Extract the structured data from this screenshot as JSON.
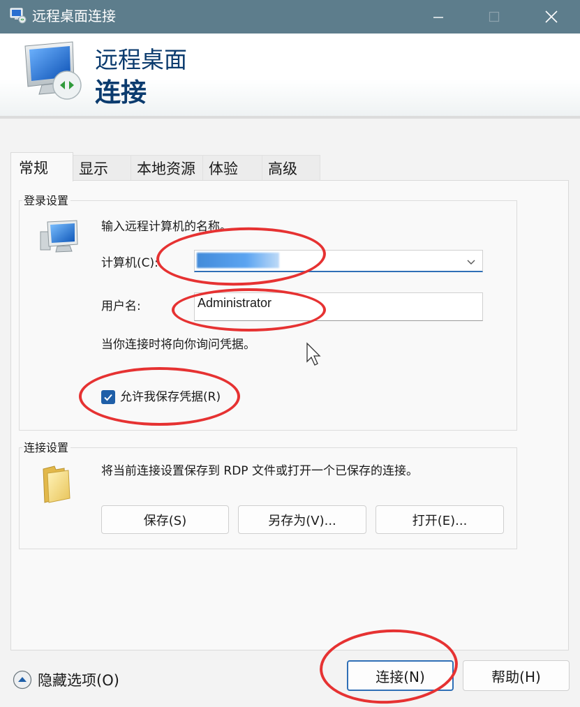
{
  "window": {
    "title": "远程桌面连接"
  },
  "banner": {
    "title": "远程桌面",
    "subtitle": "连接"
  },
  "tabs": [
    {
      "label": "常规",
      "active": true
    },
    {
      "label": "显示",
      "active": false
    },
    {
      "label": "本地资源",
      "active": false
    },
    {
      "label": "体验",
      "active": false
    },
    {
      "label": "高级",
      "active": false
    }
  ],
  "login_settings": {
    "group_label": "登录设置",
    "instruction": "输入远程计算机的名称。",
    "computer_label": "计算机(C):",
    "computer_value": "",
    "username_label": "用户名:",
    "username_value": "Administrator",
    "credentials_note": "当你连接时将向你询问凭据。",
    "remember_checkbox_label": "允许我保存凭据(R)",
    "remember_checked": true
  },
  "connection_settings": {
    "group_label": "连接设置",
    "description": "将当前连接设置保存到 RDP 文件或打开一个已保存的连接。",
    "save_label": "保存(S)",
    "save_as_label": "另存为(V)...",
    "open_label": "打开(E)..."
  },
  "footer": {
    "hide_options_label": "隐藏选项(O)",
    "connect_label": "连接(N)",
    "help_label": "帮助(H)"
  },
  "colors": {
    "titlebar": "#5d7d8c",
    "accent": "#1f5fa8",
    "banner_text": "#0b3b6e",
    "annotation": "#e63232"
  }
}
